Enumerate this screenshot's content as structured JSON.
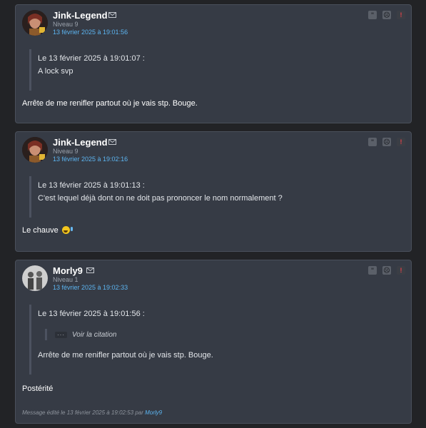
{
  "colors": {
    "background": "#222326",
    "card": "#363b45",
    "link": "#5cb4f0",
    "alert": "#e0424a"
  },
  "posts": [
    {
      "author": "Jink-Legend",
      "level": "Niveau 9",
      "date": "13 février 2025 à 19:01:56",
      "avatar_icon": "avatar-photo-woman",
      "quote": {
        "header": "Le 13 février 2025 à 19:01:07 :",
        "text": "A lock svp"
      },
      "message": "Arrête de me renifler partout où je vais stp. Bouge."
    },
    {
      "author": "Jink-Legend",
      "level": "Niveau 9",
      "date": "13 février 2025 à 19:02:16",
      "avatar_icon": "avatar-photo-woman",
      "quote": {
        "header": "Le 13 février 2025 à 19:01:13 :",
        "text": "C'est lequel déjà dont on ne doit pas prononcer le nom normalement ?"
      },
      "message": "Le chauve"
    },
    {
      "author": "Morly9",
      "level": "Niveau 1",
      "date": "13 février 2025 à 19:02:33",
      "avatar_icon": "avatar-photo-group",
      "quote": {
        "header": "Le 13 février 2025 à 19:01:56 :",
        "nested_dots": "···",
        "nested_label": "Voir la citation",
        "text": "Arrête de me renifler partout où je vais stp. Bouge."
      },
      "message": "Postérité",
      "edited": {
        "text": "Message édité le 13 février 2025 à 19:02:53 par",
        "by": "Morly9"
      }
    }
  ],
  "action_icons": [
    "quote-icon",
    "mp-icon",
    "report-icon"
  ]
}
